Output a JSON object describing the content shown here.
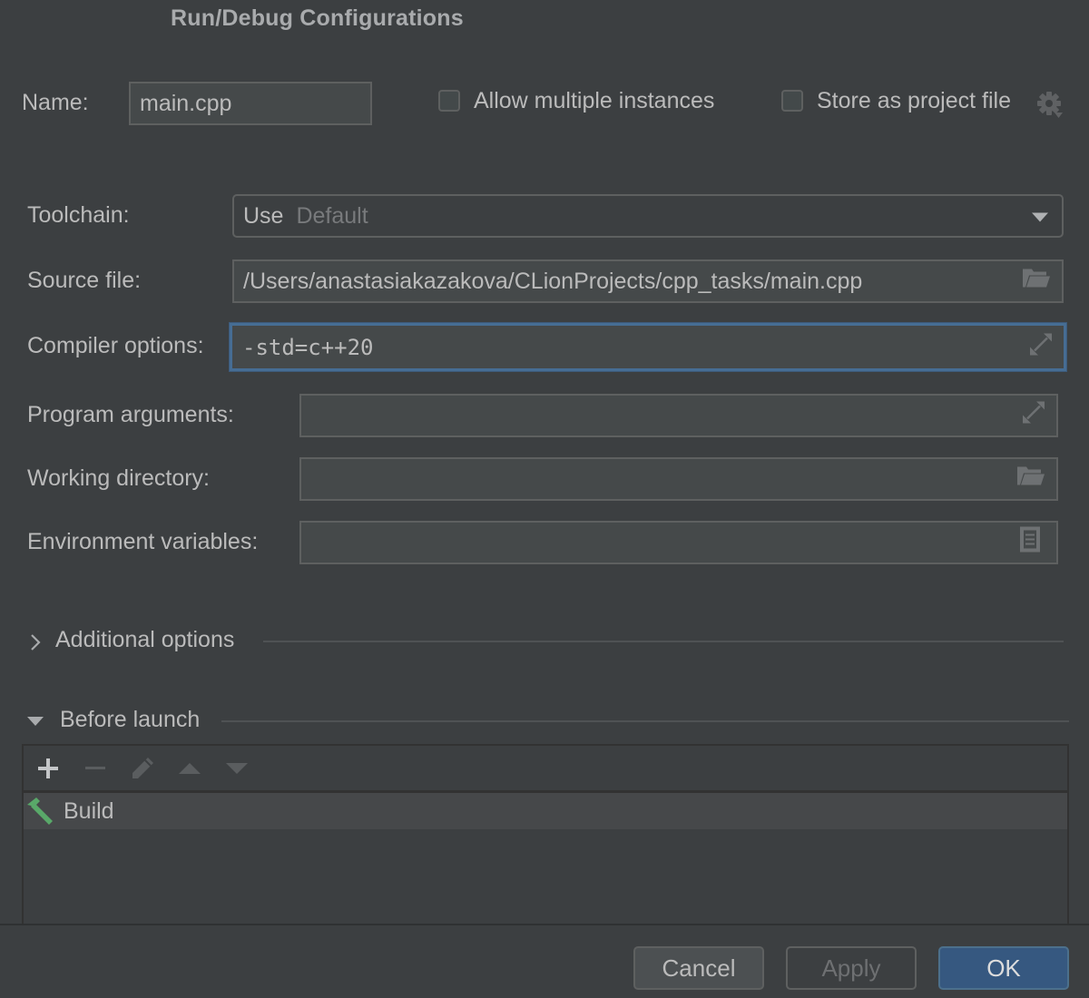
{
  "dialog": {
    "title": "Run/Debug Configurations"
  },
  "header": {
    "name_label": "Name:",
    "name_value": "main.cpp",
    "allow_multiple": {
      "label": "Allow multiple instances",
      "checked": false
    },
    "store_project": {
      "label": "Store as project file",
      "checked": false
    },
    "settings_icon": "gear-dropdown-icon"
  },
  "form": {
    "toolchain": {
      "label": "Toolchain:",
      "prefix": "Use",
      "value": "Default",
      "icon": "chevron-down-icon"
    },
    "source_file": {
      "label": "Source file:",
      "value": "/Users/anastasiakazakova/CLionProjects/cpp_tasks/main.cpp",
      "icon": "folder-icon"
    },
    "compiler_options": {
      "label": "Compiler options:",
      "value": "-std=c++20",
      "icon": "expand-icon"
    },
    "program_arguments": {
      "label": "Program arguments:",
      "value": "",
      "icon": "expand-icon"
    },
    "working_directory": {
      "label": "Working directory:",
      "value": "",
      "icon": "folder-icon"
    },
    "environment_variables": {
      "label": "Environment variables:",
      "value": "",
      "icon": "document-icon"
    }
  },
  "sections": {
    "additional_options": {
      "label": "Additional options",
      "expanded": false
    },
    "before_launch": {
      "label": "Before launch",
      "expanded": true
    }
  },
  "before_launch": {
    "toolbar": [
      "add",
      "remove",
      "edit",
      "move-up",
      "move-down"
    ],
    "items": [
      {
        "label": "Build",
        "icon": "hammer-icon"
      }
    ]
  },
  "buttons": {
    "cancel": "Cancel",
    "apply": "Apply",
    "ok": "OK"
  },
  "colors": {
    "background": "#3c3f41",
    "focus_border": "#466d94",
    "ok_button": "#365880",
    "build_icon": "#59a869"
  }
}
